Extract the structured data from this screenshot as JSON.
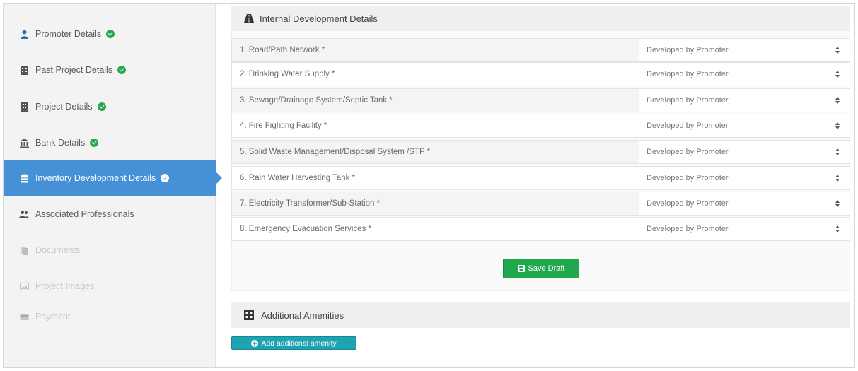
{
  "sidebar": {
    "items": [
      {
        "label": "Promoter Details",
        "icon": "user-tie-icon",
        "completed": true,
        "state": "normal"
      },
      {
        "label": "Past Project Details",
        "icon": "building-icon",
        "completed": true,
        "state": "normal"
      },
      {
        "label": "Project Details",
        "icon": "building-icon",
        "completed": true,
        "state": "normal"
      },
      {
        "label": "Bank Details",
        "icon": "bank-icon",
        "completed": true,
        "state": "normal"
      },
      {
        "label": "Inventory Development Details",
        "icon": "database-icon",
        "completed": true,
        "state": "active"
      },
      {
        "label": "Associated Professionals",
        "icon": "users-icon",
        "completed": false,
        "state": "normal"
      },
      {
        "label": "Documents",
        "icon": "documents-icon",
        "completed": false,
        "state": "disabled"
      },
      {
        "label": "Project Images",
        "icon": "image-icon",
        "completed": false,
        "state": "disabled"
      },
      {
        "label": "Payment",
        "icon": "credit-card-icon",
        "completed": false,
        "state": "disabled"
      }
    ]
  },
  "internal": {
    "title": "Internal Development Details",
    "icon": "road-icon",
    "rows": [
      {
        "label": "1.  Road/Path Network *",
        "value": "Developed by Promoter"
      },
      {
        "label": "2.  Drinking Water Supply *",
        "value": "Developed by Promoter"
      },
      {
        "label": "3.  Sewage/Drainage System/Septic Tank *",
        "value": "Developed by Promoter"
      },
      {
        "label": "4.  Fire Fighting Facility *",
        "value": "Developed by Promoter"
      },
      {
        "label": "5.  Solid Waste Management/Disposal System /STP *",
        "value": "Developed by Promoter"
      },
      {
        "label": "6.  Rain Water Harvesting Tank *",
        "value": "Developed by Promoter"
      },
      {
        "label": "7.  Electricity Transformer/Sub-Station *",
        "value": "Developed by Promoter"
      },
      {
        "label": "8.  Emergency Evacuation Services *",
        "value": "Developed by Promoter"
      }
    ],
    "save_label": "Save Draft"
  },
  "amenities": {
    "title": "Additional Amenities",
    "icon": "building-icon",
    "add_label": "Add additional amenity"
  },
  "colors": {
    "active": "#4690d6",
    "success": "#20a84f",
    "info": "#1fa2b1"
  }
}
